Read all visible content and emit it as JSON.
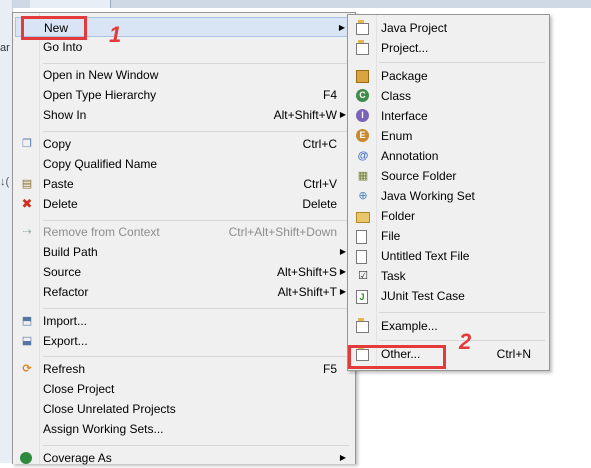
{
  "context_menu": {
    "items": [
      {
        "label": "New",
        "shortcut": "",
        "submenu": true
      },
      {
        "label": "Go Into",
        "shortcut": ""
      },
      {
        "label": "Open in New Window",
        "shortcut": ""
      },
      {
        "label": "Open Type Hierarchy",
        "shortcut": "F4"
      },
      {
        "label": "Show In",
        "shortcut": "Alt+Shift+W",
        "submenu": true
      },
      {
        "label": "Copy",
        "shortcut": "Ctrl+C"
      },
      {
        "label": "Copy Qualified Name",
        "shortcut": ""
      },
      {
        "label": "Paste",
        "shortcut": "Ctrl+V"
      },
      {
        "label": "Delete",
        "shortcut": "Delete"
      },
      {
        "label": "Remove from Context",
        "shortcut": "Ctrl+Alt+Shift+Down",
        "disabled": true
      },
      {
        "label": "Build Path",
        "shortcut": "",
        "submenu": true
      },
      {
        "label": "Source",
        "shortcut": "Alt+Shift+S",
        "submenu": true
      },
      {
        "label": "Refactor",
        "shortcut": "Alt+Shift+T",
        "submenu": true
      },
      {
        "label": "Import...",
        "shortcut": ""
      },
      {
        "label": "Export...",
        "shortcut": ""
      },
      {
        "label": "Refresh",
        "shortcut": "F5"
      },
      {
        "label": "Close Project",
        "shortcut": ""
      },
      {
        "label": "Close Unrelated Projects",
        "shortcut": ""
      },
      {
        "label": "Assign Working Sets...",
        "shortcut": ""
      },
      {
        "label": "Coverage As",
        "shortcut": "",
        "submenu": true
      }
    ]
  },
  "new_submenu": {
    "items": [
      {
        "label": "Java Project",
        "icon": "java-project-icon"
      },
      {
        "label": "Project...",
        "icon": "project-icon"
      },
      {
        "label": "Package",
        "icon": "package-icon"
      },
      {
        "label": "Class",
        "icon": "class-icon"
      },
      {
        "label": "Interface",
        "icon": "interface-icon"
      },
      {
        "label": "Enum",
        "icon": "enum-icon"
      },
      {
        "label": "Annotation",
        "icon": "annotation-icon"
      },
      {
        "label": "Source Folder",
        "icon": "source-folder-icon"
      },
      {
        "label": "Java Working Set",
        "icon": "working-set-icon"
      },
      {
        "label": "Folder",
        "icon": "folder-icon"
      },
      {
        "label": "File",
        "icon": "file-icon"
      },
      {
        "label": "Untitled Text File",
        "icon": "text-file-icon"
      },
      {
        "label": "Task",
        "icon": "task-icon"
      },
      {
        "label": "JUnit Test Case",
        "icon": "junit-icon"
      },
      {
        "label": "Example...",
        "icon": "example-icon"
      },
      {
        "label": "Other...",
        "shortcut": "Ctrl+N",
        "icon": "other-icon"
      }
    ]
  },
  "background": {
    "edge_text_1": "ar",
    "edge_text_2": "↓("
  },
  "colors": {
    "annotation_red": "#e53a3a",
    "menu_bg": "#f0f0f0",
    "highlight_bg": "#d9e5f4"
  }
}
